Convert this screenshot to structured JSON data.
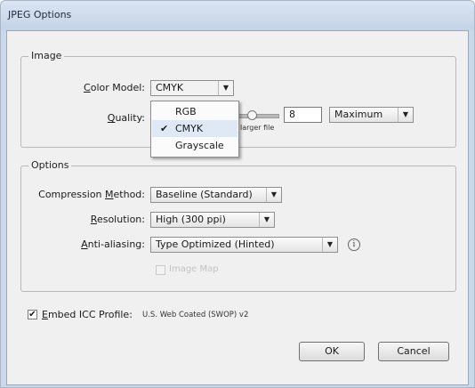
{
  "window": {
    "title": "JPEG Options"
  },
  "image_group": {
    "legend": "Image",
    "color_model": {
      "label_pre": "",
      "label_ul": "C",
      "label_post": "olor Model:",
      "value": "CMYK",
      "options": [
        "RGB",
        "CMYK",
        "Grayscale"
      ],
      "selected_index": 1,
      "check_glyph": "✔"
    },
    "quality": {
      "label_ul": "Q",
      "label_post": "uality:",
      "value": "8",
      "preset": "Maximum",
      "slider_hint": "larger file"
    }
  },
  "options_group": {
    "legend": "Options",
    "compression_method": {
      "label_pre": "Compression ",
      "label_ul": "M",
      "label_post": "ethod:",
      "value": "Baseline (Standard)"
    },
    "resolution": {
      "label_ul": "R",
      "label_post": "esolution:",
      "value": "High (300 ppi)"
    },
    "anti_aliasing": {
      "label_ul": "A",
      "label_post": "nti-aliasing:",
      "value": "Type Optimized (Hinted)",
      "info_glyph": "i"
    },
    "image_map": {
      "label": "Image Map",
      "checked": false,
      "enabled": false
    }
  },
  "embed_icc": {
    "checked": true,
    "check_glyph": "✔",
    "label_ul": "E",
    "label_post": "mbed ICC Profile:",
    "profile": "U.S. Web Coated (SWOP) v2"
  },
  "buttons": {
    "ok": "OK",
    "cancel": "Cancel"
  },
  "dropdown_arrow": "▼"
}
